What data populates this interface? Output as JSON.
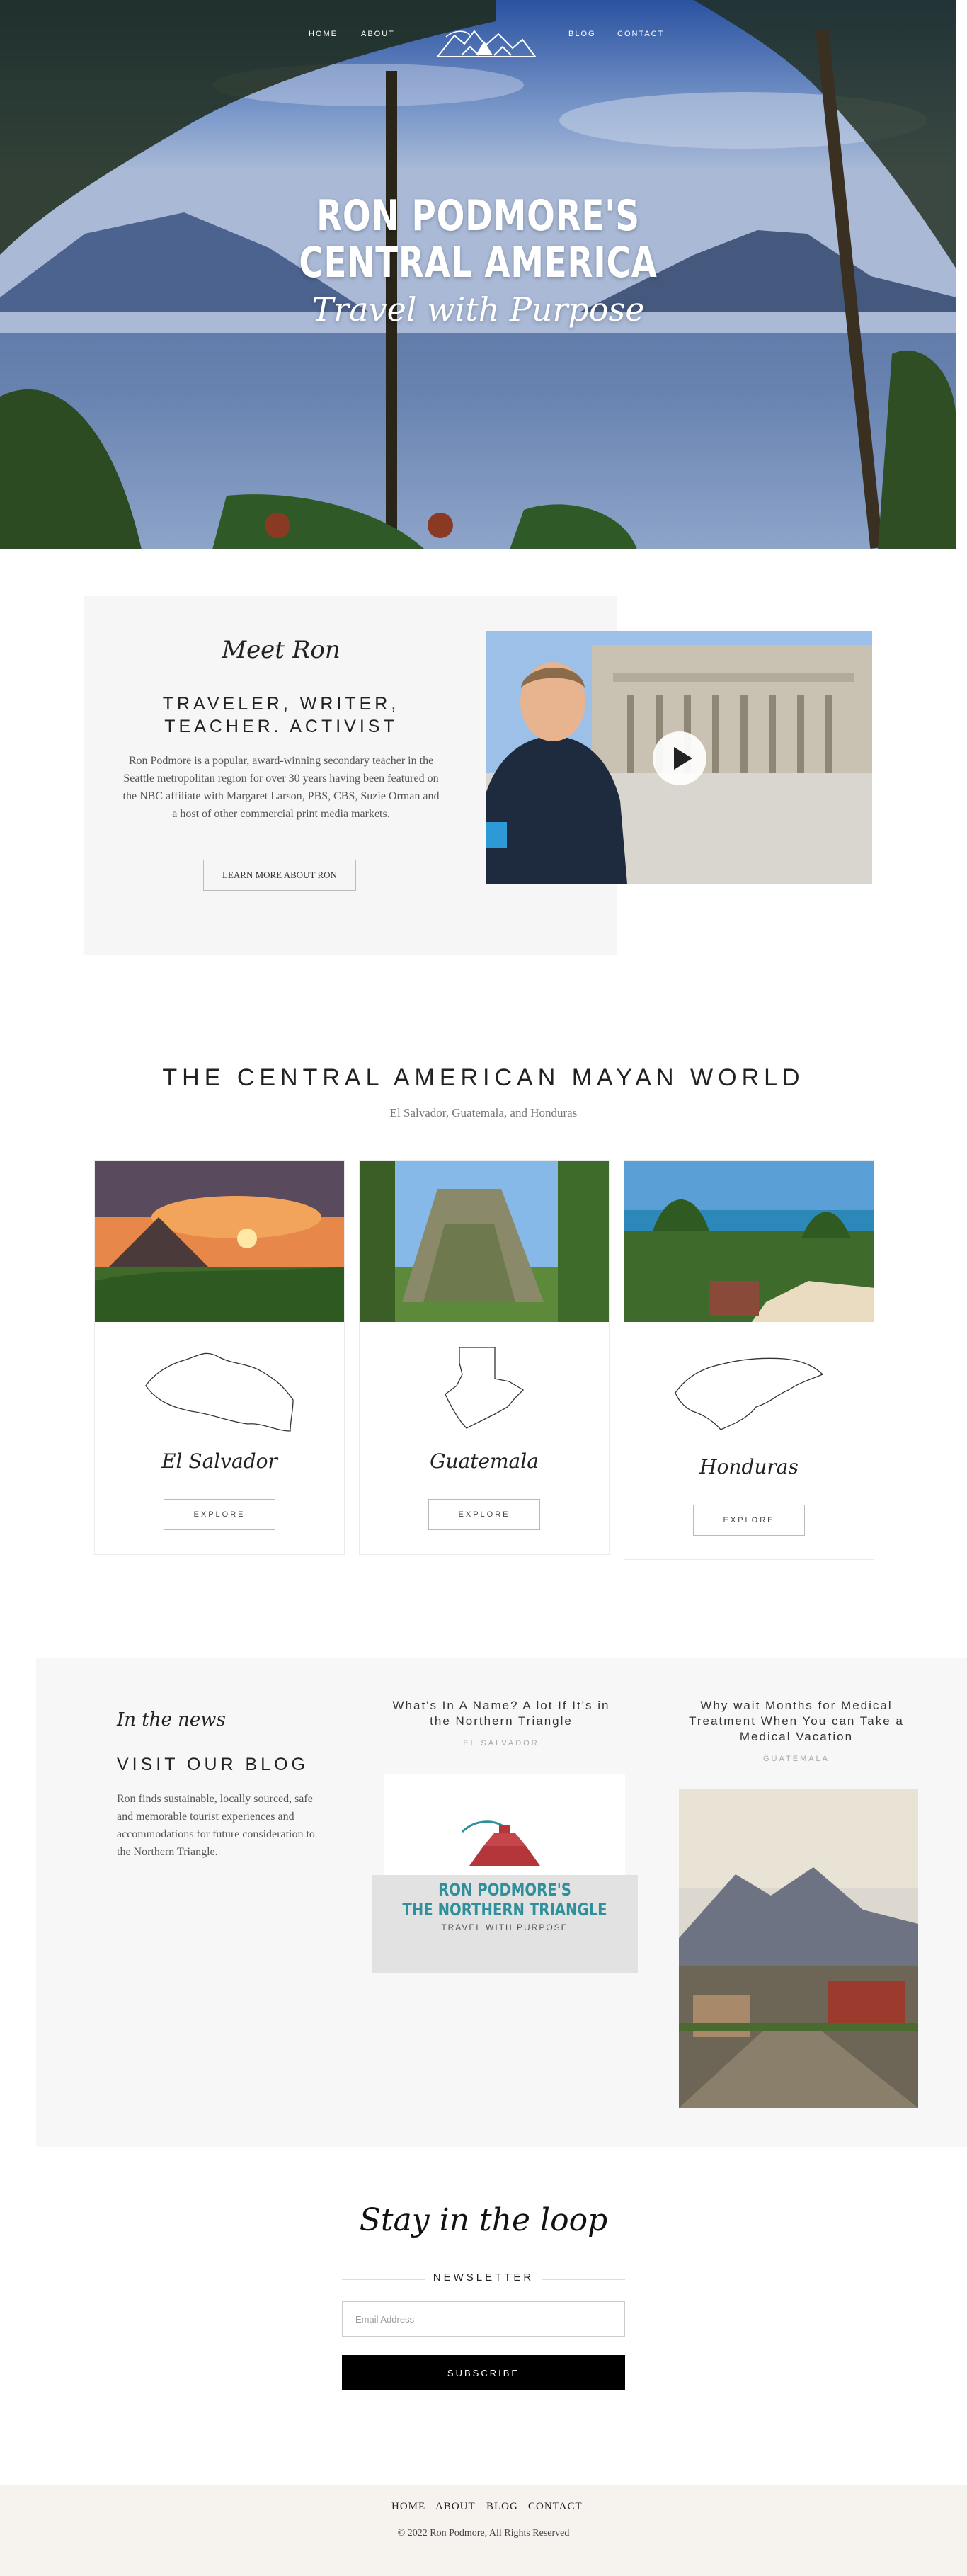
{
  "nav": {
    "items": [
      "HOME",
      "ABOUT",
      "BLOG",
      "CONTACT"
    ]
  },
  "hero": {
    "title_line1": "RON PODMORE'S",
    "title_line2": "CENTRAL AMERICA",
    "subtitle": "Travel with Purpose"
  },
  "meet": {
    "script": "Meet Ron",
    "heading_line1": "TRAVELER, WRITER,",
    "heading_line2": "TEACHER. ACTIVIST",
    "body": "Ron Podmore is a popular, award-winning secondary teacher in the Seattle metropolitan region for over 30 years having been featured on the NBC affiliate with Margaret Larson, PBS, CBS, Suzie Orman and a host of other commercial print media markets.",
    "button": "LEARN MORE ABOUT RON"
  },
  "mayan": {
    "title": "THE CENTRAL AMERICAN MAYAN WORLD",
    "subtitle": "El Salvador, Guatemala, and Honduras",
    "cards": [
      {
        "name": "El Salvador",
        "button": "EXPLORE"
      },
      {
        "name": "Guatemala",
        "button": "EXPLORE"
      },
      {
        "name": "Honduras",
        "button": "EXPLORE"
      }
    ]
  },
  "blog": {
    "script": "In the news",
    "heading": "VISIT OUR BLOG",
    "body": "Ron finds sustainable, locally sourced, safe and memorable tourist experiences and accommodations for future consideration to the Northern Triangle.",
    "posts": [
      {
        "title": "What's In A Name? A lot If It's in the Northern Triangle",
        "tag": "EL SALVADOR",
        "image_title_line1": "RON PODMORE'S",
        "image_title_line2": "THE NORTHERN TRIANGLE",
        "image_subtitle": "TRAVEL WITH PURPOSE"
      },
      {
        "title": "Why wait Months for Medical Treatment When You can Take a Medical Vacation",
        "tag": "GUATEMALA"
      }
    ]
  },
  "newsletter": {
    "script": "Stay in the loop",
    "label": "NEWSLETTER",
    "email_placeholder": "Email Address",
    "button": "SUBSCRIBE"
  },
  "footer": {
    "links": [
      "HOME",
      "ABOUT",
      "BLOG",
      "CONTACT"
    ],
    "copyright": "© 2022 Ron Podmore, All Rights Reserved"
  },
  "colors": {
    "accent_teal": "#2f8f9a",
    "accent_red": "#b5363a",
    "panel_grey": "#f6f6f6",
    "footer_bg": "#f6f2ee",
    "button_black": "#000000"
  }
}
